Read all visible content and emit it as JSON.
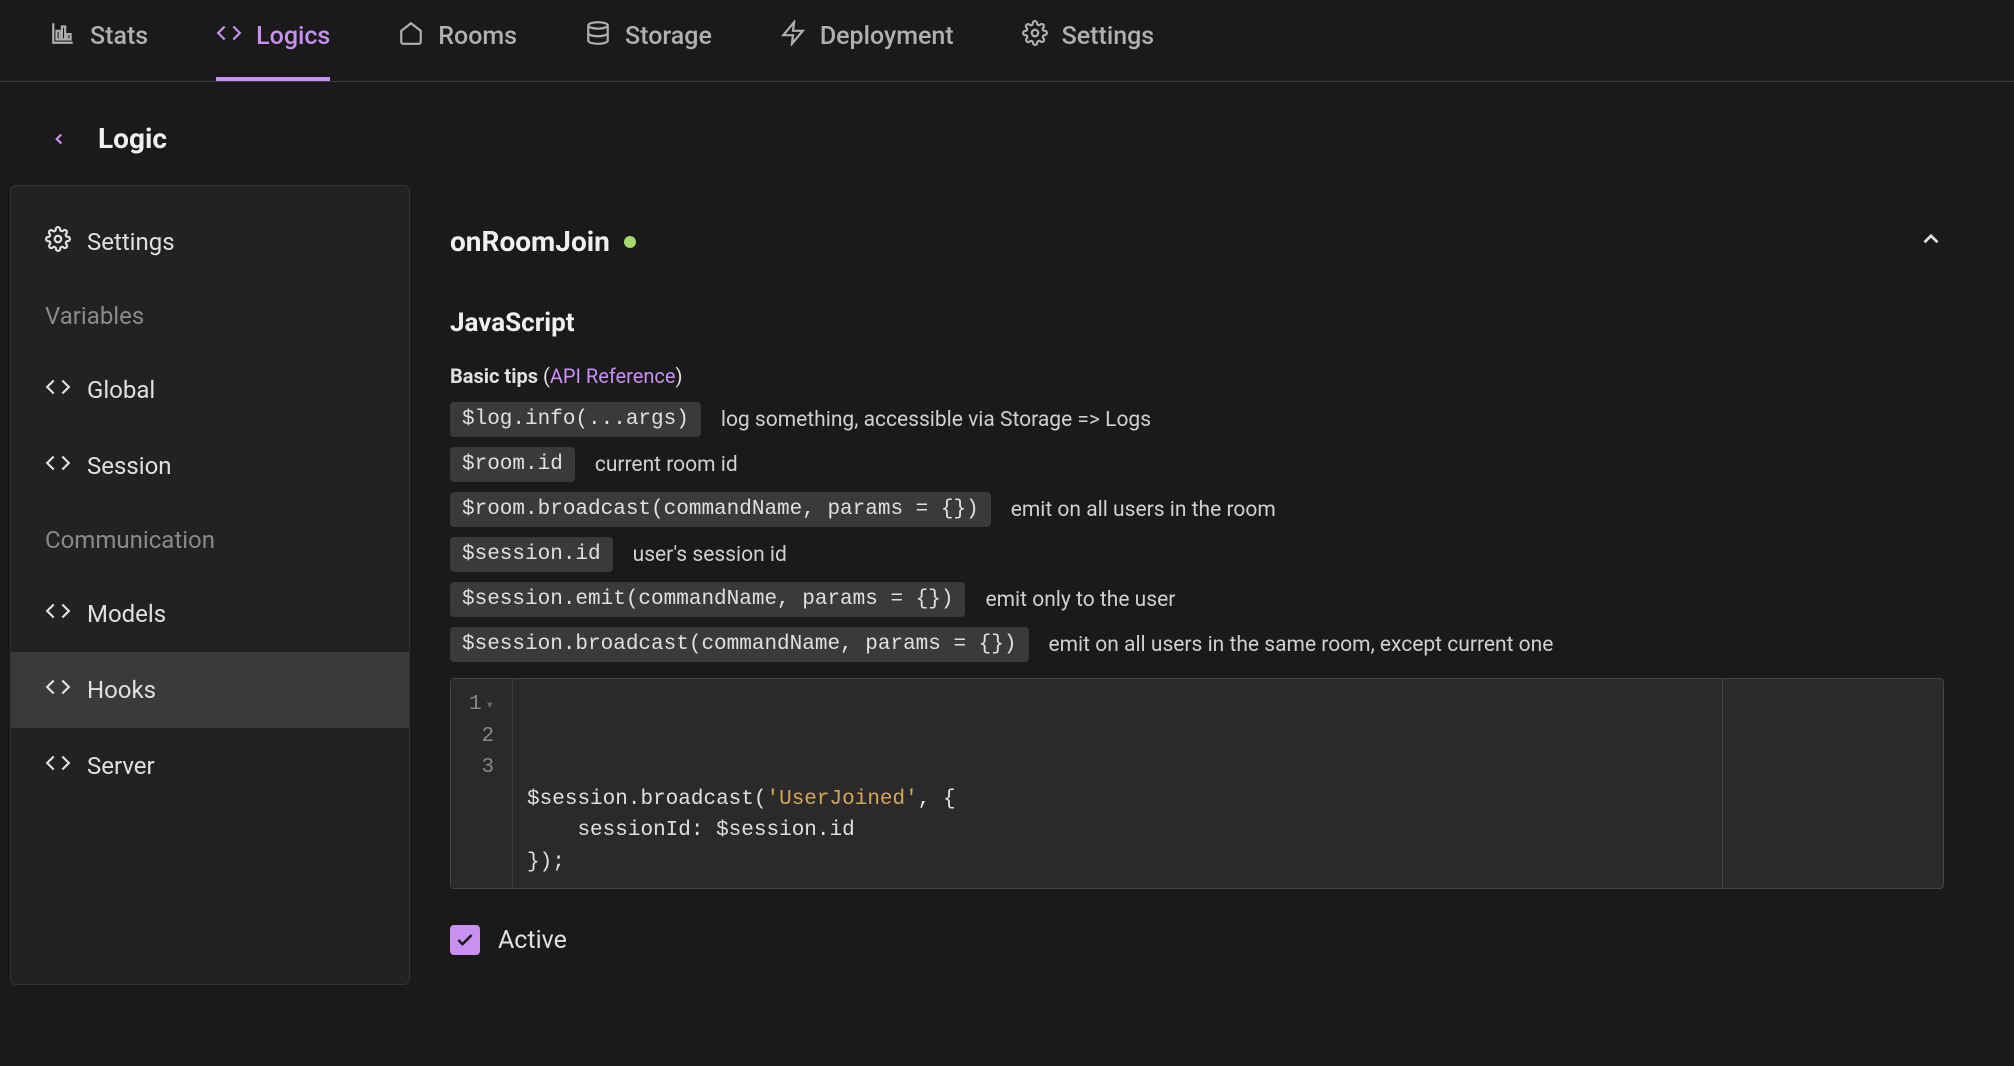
{
  "tabs": [
    {
      "label": "Stats",
      "icon": "stats"
    },
    {
      "label": "Logics",
      "icon": "code",
      "active": true
    },
    {
      "label": "Rooms",
      "icon": "home"
    },
    {
      "label": "Storage",
      "icon": "database"
    },
    {
      "label": "Deployment",
      "icon": "bolt"
    },
    {
      "label": "Settings",
      "icon": "gear"
    }
  ],
  "page_title": "Logic",
  "sidebar": {
    "settings_label": "Settings",
    "section_variables": "Variables",
    "section_communication": "Communication",
    "items": {
      "global": "Global",
      "session": "Session",
      "models": "Models",
      "hooks": "Hooks",
      "server": "Server"
    }
  },
  "hook": {
    "name": "onRoomJoin",
    "language": "JavaScript",
    "tips_label": "Basic tips",
    "api_ref_label": "API Reference",
    "tips": [
      {
        "code": "$log.info(...args)",
        "desc": "log something, accessible via Storage => Logs"
      },
      {
        "code": "$room.id",
        "desc": "current room id"
      },
      {
        "code": "$room.broadcast(commandName, params = {})",
        "desc": "emit on all users in the room"
      },
      {
        "code": "$session.id",
        "desc": "user's session id"
      },
      {
        "code": "$session.emit(commandName, params = {})",
        "desc": "emit only to the user"
      },
      {
        "code": "$session.broadcast(commandName, params = {})",
        "desc": "emit on all users in the same room, except current one"
      }
    ],
    "code_lines": [
      {
        "n": 1,
        "pre": "$session.broadcast(",
        "str": "'UserJoined'",
        "post": ", {"
      },
      {
        "n": 2,
        "pre": "    sessionId: $session.id",
        "str": "",
        "post": ""
      },
      {
        "n": 3,
        "pre": "});",
        "str": "",
        "post": ""
      }
    ],
    "active_label": "Active",
    "active_checked": true
  }
}
